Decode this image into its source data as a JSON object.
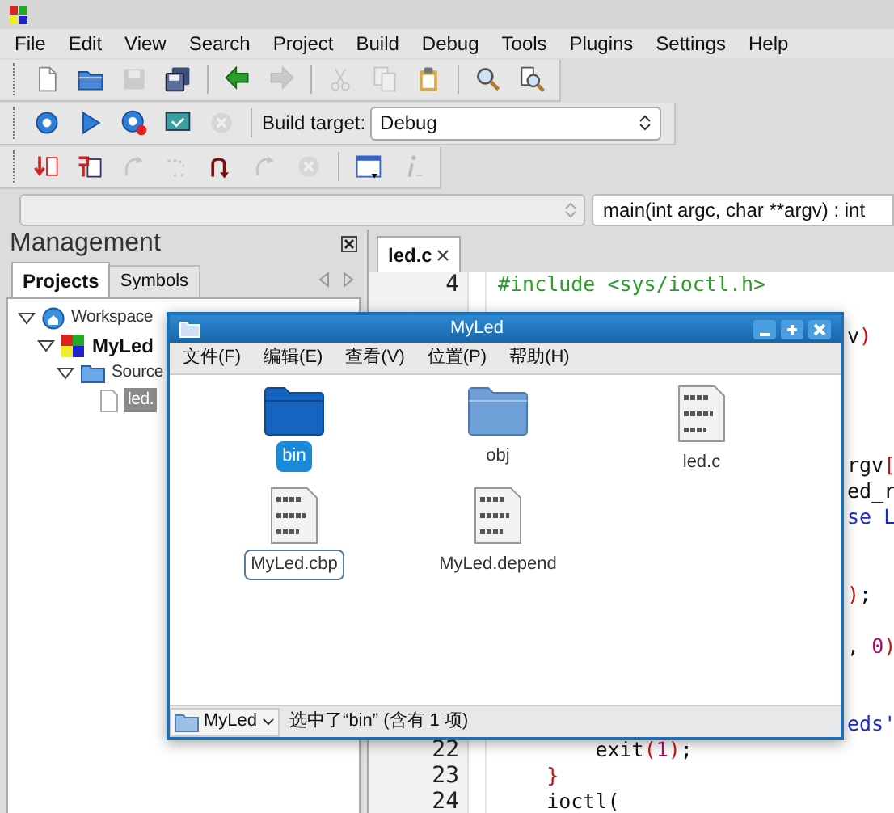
{
  "menu": [
    "File",
    "Edit",
    "View",
    "Search",
    "Project",
    "Build",
    "Debug",
    "Tools",
    "Plugins",
    "Settings",
    "Help"
  ],
  "toolbars": [
    {
      "buttons": [
        {
          "kind": "button",
          "disabled": false
        },
        {
          "kind": "button",
          "disabled": false
        },
        {
          "kind": "button",
          "disabled": true
        },
        {
          "kind": "button",
          "disabled": false
        },
        {
          "kind": "separator"
        },
        {
          "kind": "button",
          "disabled": false
        },
        {
          "kind": "button",
          "disabled": true
        },
        {
          "kind": "separator"
        },
        {
          "kind": "button",
          "disabled": true
        },
        {
          "kind": "button",
          "disabled": true
        },
        {
          "kind": "button",
          "disabled": false
        },
        {
          "kind": "separator"
        },
        {
          "kind": "button",
          "disabled": false
        },
        {
          "kind": "button",
          "disabled": false
        }
      ]
    },
    {
      "buttons": [
        {
          "kind": "button",
          "disabled": false
        },
        {
          "kind": "button",
          "disabled": false
        },
        {
          "kind": "button",
          "disabled": false
        },
        {
          "kind": "button",
          "disabled": false
        },
        {
          "kind": "button",
          "disabled": true
        },
        {
          "kind": "separator"
        }
      ],
      "label": "Build target:",
      "select": "Debug"
    },
    {
      "buttons": [
        {
          "kind": "button",
          "disabled": false
        },
        {
          "kind": "button",
          "disabled": false
        },
        {
          "kind": "button",
          "disabled": true
        },
        {
          "kind": "button",
          "disabled": true
        },
        {
          "kind": "button",
          "disabled": false
        },
        {
          "kind": "button",
          "disabled": true
        },
        {
          "kind": "button",
          "disabled": true
        },
        {
          "kind": "separator"
        },
        {
          "kind": "button",
          "disabled": false
        },
        {
          "kind": "button",
          "disabled": true
        }
      ]
    }
  ],
  "function_combo": "main(int argc, char **argv) : int",
  "management": {
    "title": "Management",
    "tabs": [
      {
        "label": "Projects",
        "selected": true
      },
      {
        "label": "Symbols",
        "selected": false
      }
    ],
    "tree": [
      {
        "label": "Workspace",
        "kind": "workspace",
        "expanded": true,
        "selected": false,
        "children": [
          {
            "label": "MyLed",
            "kind": "project",
            "expanded": true,
            "selected": false,
            "children": [
              {
                "label": "Source",
                "kind": "folder",
                "expanded": true,
                "selected": false,
                "children": [
                  {
                    "label": "led.",
                    "kind": "file",
                    "selected": true
                  }
                ]
              }
            ]
          }
        ]
      }
    ]
  },
  "editor": {
    "tabs": [
      {
        "label": "led.c",
        "selected": true
      }
    ],
    "lines": [
      {
        "kind": "full",
        "number": "4",
        "segments": [
          {
            "text": "#include <sys/ioctl.h>",
            "kind": "preproc"
          }
        ]
      },
      {
        "kind": "blank"
      },
      {
        "kind": "fragment",
        "segments": [
          {
            "text": "v",
            "kind": "plain"
          },
          {
            "text": ")",
            "kind": "op"
          }
        ]
      },
      {
        "kind": "blank"
      },
      {
        "kind": "blank"
      },
      {
        "kind": "blank"
      },
      {
        "kind": "blank"
      },
      {
        "kind": "fragment",
        "segments": [
          {
            "text": "rgv",
            "kind": "plain"
          },
          {
            "text": "[",
            "kind": "op"
          }
        ]
      },
      {
        "kind": "fragment",
        "segments": [
          {
            "text": "ed_r",
            "kind": "plain"
          }
        ]
      },
      {
        "kind": "fragment",
        "segments": [
          {
            "text": "se L",
            "kind": "keyword"
          }
        ]
      },
      {
        "kind": "blank"
      },
      {
        "kind": "blank"
      },
      {
        "kind": "fragment",
        "segments": [
          {
            "text": ")",
            "kind": "op"
          },
          {
            "text": ";",
            "kind": "plain"
          }
        ]
      },
      {
        "kind": "blank"
      },
      {
        "kind": "fragment",
        "segments": [
          {
            "text": ", ",
            "kind": "plain"
          },
          {
            "text": "0",
            "kind": "number"
          },
          {
            "text": ")",
            "kind": "op"
          }
        ]
      },
      {
        "kind": "blank"
      },
      {
        "kind": "blank"
      },
      {
        "kind": "fragment",
        "segments": [
          {
            "text": "eds'",
            "kind": "string"
          }
        ]
      },
      {
        "kind": "full",
        "number": "22",
        "segments": [
          {
            "text": "        exit",
            "kind": "plain"
          },
          {
            "text": "(",
            "kind": "op"
          },
          {
            "text": "1",
            "kind": "number"
          },
          {
            "text": ")",
            "kind": "op"
          },
          {
            "text": ";",
            "kind": "plain"
          }
        ]
      },
      {
        "kind": "full",
        "number": "23",
        "segments": [
          {
            "text": "    }",
            "kind": "op"
          }
        ]
      },
      {
        "kind": "full",
        "number": "24",
        "segments": [
          {
            "text": "    ioctl(",
            "kind": "plain"
          }
        ]
      }
    ]
  },
  "file_window": {
    "title": "MyLed",
    "menu": [
      "文件(F)",
      "编辑(E)",
      "查看(V)",
      "位置(P)",
      "帮助(H)"
    ],
    "items": [
      {
        "label": "bin",
        "kind": "folder",
        "selected": true,
        "focused": false
      },
      {
        "label": "obj",
        "kind": "folder",
        "selected": false,
        "focused": false
      },
      {
        "label": "led.c",
        "kind": "text",
        "selected": false,
        "focused": false
      },
      {
        "label": "MyLed.cbp",
        "kind": "text",
        "selected": false,
        "focused": true
      },
      {
        "label": "MyLed.depend",
        "kind": "text",
        "selected": false,
        "focused": false
      }
    ],
    "location": "MyLed",
    "status": "选中了“bin” (含有 1 项)"
  }
}
